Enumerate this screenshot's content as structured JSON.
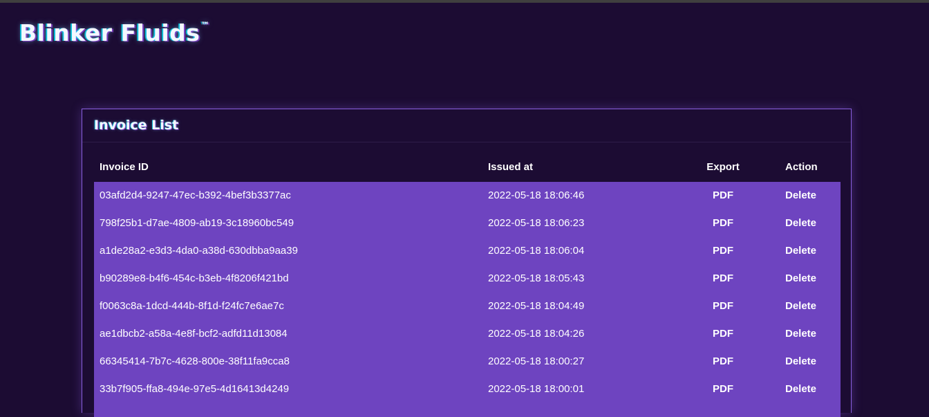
{
  "brand": {
    "name": "Blinker Fluids",
    "trademark": "™"
  },
  "invoice_list": {
    "title": "Invoice List",
    "columns": {
      "invoice_id": "Invoice ID",
      "issued_at": "Issued at",
      "export": "Export",
      "action": "Action"
    },
    "rows": [
      {
        "id": "03afd2d4-9247-47ec-b392-4bef3b3377ac",
        "issued_at": "2022-05-18 18:06:46",
        "export": "PDF",
        "action": "Delete"
      },
      {
        "id": "798f25b1-d7ae-4809-ab19-3c18960bc549",
        "issued_at": "2022-05-18 18:06:23",
        "export": "PDF",
        "action": "Delete"
      },
      {
        "id": "a1de28a2-e3d3-4da0-a38d-630dbba9aa39",
        "issued_at": "2022-05-18 18:06:04",
        "export": "PDF",
        "action": "Delete"
      },
      {
        "id": "b90289e8-b4f6-454c-b3eb-4f8206f421bd",
        "issued_at": "2022-05-18 18:05:43",
        "export": "PDF",
        "action": "Delete"
      },
      {
        "id": "f0063c8a-1dcd-444b-8f1d-f24fc7e6ae7c",
        "issued_at": "2022-05-18 18:04:49",
        "export": "PDF",
        "action": "Delete"
      },
      {
        "id": "ae1dbcb2-a58a-4e8f-bcf2-adfd11d13084",
        "issued_at": "2022-05-18 18:04:26",
        "export": "PDF",
        "action": "Delete"
      },
      {
        "id": "66345414-7b7c-4628-800e-38f11fa9cca8",
        "issued_at": "2022-05-18 18:00:27",
        "export": "PDF",
        "action": "Delete"
      },
      {
        "id": "33b7f905-ffa8-494e-97e5-4d16413d4249",
        "issued_at": "2022-05-18 18:00:01",
        "export": "PDF",
        "action": "Delete"
      }
    ]
  },
  "colors": {
    "background": "#1c0c33",
    "row_background": "#6e44c0",
    "card_border": "#8a5fe0"
  }
}
